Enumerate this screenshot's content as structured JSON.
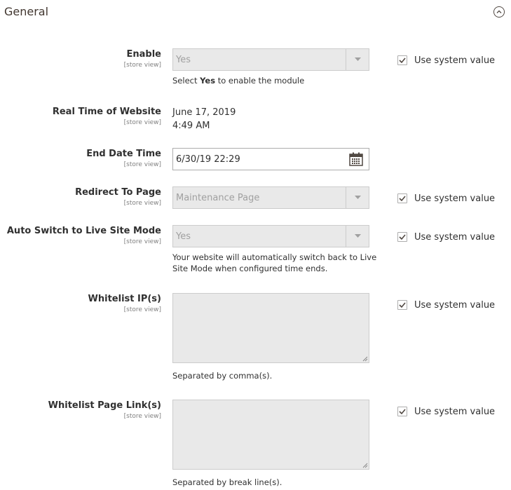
{
  "section": {
    "title": "General",
    "collapse_icon": "chevron-up-icon"
  },
  "scope_label": "[store view]",
  "use_system_value_label": "Use system value",
  "fields": {
    "enable": {
      "label": "Enable",
      "value": "Yes",
      "note_prefix": "Select ",
      "note_bold": "Yes",
      "note_suffix": " to enable the module",
      "use_system_value": true
    },
    "real_time": {
      "label": "Real Time of Website",
      "date": "June 17, 2019",
      "time": "4:49 AM"
    },
    "end_date_time": {
      "label": "End Date Time",
      "value": "6/30/19 22:29",
      "icon": "calendar-icon"
    },
    "redirect_to_page": {
      "label": "Redirect To Page",
      "value": "Maintenance Page",
      "use_system_value": true
    },
    "auto_switch": {
      "label": "Auto Switch to Live Site Mode",
      "value": "Yes",
      "note_line1": "Your website will automatically switch back to Live",
      "note_line2": "Site Mode when configured time ends.",
      "use_system_value": true
    },
    "whitelist_ips": {
      "label": "Whitelist IP(s)",
      "value": "",
      "note": "Separated by comma(s).",
      "use_system_value": true
    },
    "whitelist_links": {
      "label": "Whitelist Page Link(s)",
      "value": "",
      "note": "Separated by break line(s).",
      "use_system_value": true
    }
  },
  "colors": {
    "disabled_bg": "#e9e9e9",
    "border": "#cccccc",
    "text": "#303030",
    "scope": "#808080"
  }
}
